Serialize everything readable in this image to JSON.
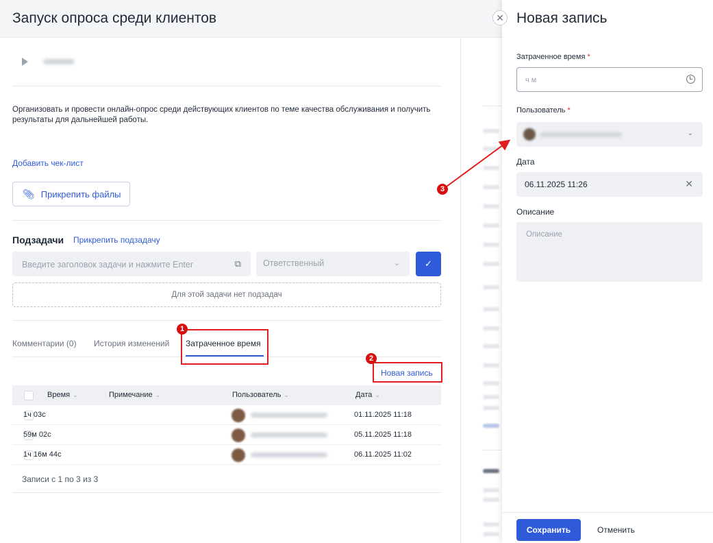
{
  "header": {
    "title": "Запуск опроса среди клиентов"
  },
  "task": {
    "description": "Организовать и провести онлайн-опрос среди действующих клиентов по теме качества обслуживания и получить результаты для дальнейшей работы.",
    "add_checklist": "Добавить чек-лист",
    "attach_files": "Прикрепить файлы"
  },
  "subtasks": {
    "title": "Подзадачи",
    "attach_link": "Прикрепить подзадачу",
    "input_placeholder": "Введите заголовок задачи и нажмите Enter",
    "responsible_placeholder": "Ответственный",
    "empty_text": "Для этой задачи нет подзадач"
  },
  "tabs": [
    {
      "label": "Комментарии (0)"
    },
    {
      "label": "История изменений"
    },
    {
      "label": "Затраченное время"
    }
  ],
  "new_record_link": "Новая запись",
  "table": {
    "columns": [
      "Время",
      "Примечание",
      "Пользователь",
      "Дата"
    ],
    "rows": [
      {
        "time": "1ч 03с",
        "note": "",
        "date": "01.11.2025 11:18"
      },
      {
        "time": "59м 02с",
        "note": "",
        "date": "05.11.2025 11:18"
      },
      {
        "time": "1ч 16м 44с",
        "note": "",
        "date": "06.11.2025 11:02"
      }
    ],
    "footer": "Записи с 1 по 3 из 3"
  },
  "badges": [
    "1",
    "2",
    "3"
  ],
  "panel": {
    "title": "Новая запись",
    "time_label": "Затраченное время",
    "time_placeholder": "ч м",
    "user_label": "Пользователь",
    "required_mark": "*",
    "date_label": "Дата",
    "date_value": "06.11.2025 11:26",
    "desc_label": "Описание",
    "desc_placeholder": "Описание",
    "save": "Сохранить",
    "cancel": "Отменить"
  },
  "colors": {
    "accent": "#2f5bd8",
    "highlight": "#e11d1d"
  },
  "icons": {
    "play": "play-icon",
    "clip": "paperclip-icon",
    "external": "external-link-icon",
    "check": "check-icon",
    "close": "close-icon",
    "clock": "clock-icon",
    "chevron": "chevron-down-icon"
  }
}
